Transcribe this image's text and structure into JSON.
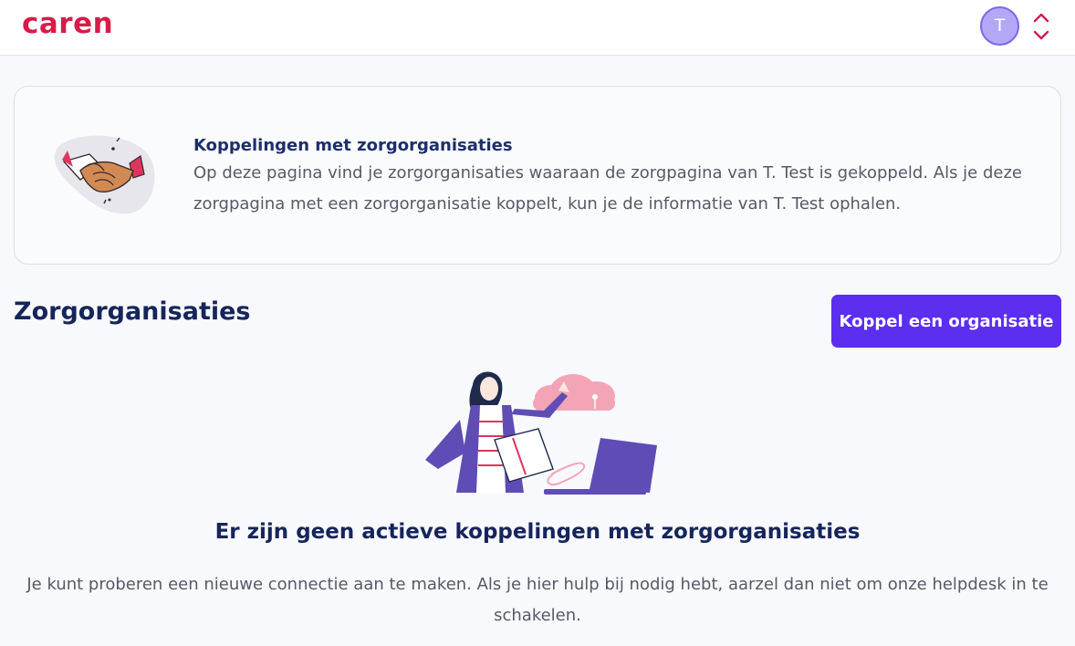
{
  "header": {
    "logo": "caren",
    "avatar_initial": "T"
  },
  "info_card": {
    "title": "Koppelingen met zorgorganisaties",
    "text": "Op deze pagina vind je zorgorganisaties waaraan de zorgpagina van T. Test is gekoppeld. Als je deze zorgpagina met een zorgorganisatie koppelt, kun je de informatie van T. Test ophalen."
  },
  "section": {
    "title": "Zorgorganisaties",
    "button_label": "Koppel een organisatie"
  },
  "empty_state": {
    "title": "Er zijn geen actieve koppelingen met zorgorganisaties",
    "text": "Je kunt proberen een nieuwe connectie aan te maken. Als je hier hulp bij nodig hebt, aarzel dan niet om onze helpdesk in te schakelen."
  },
  "colors": {
    "brand": "#d81b4a",
    "primary": "#5b2ef0",
    "avatar": "#b3a8f6",
    "heading": "#16255a"
  }
}
